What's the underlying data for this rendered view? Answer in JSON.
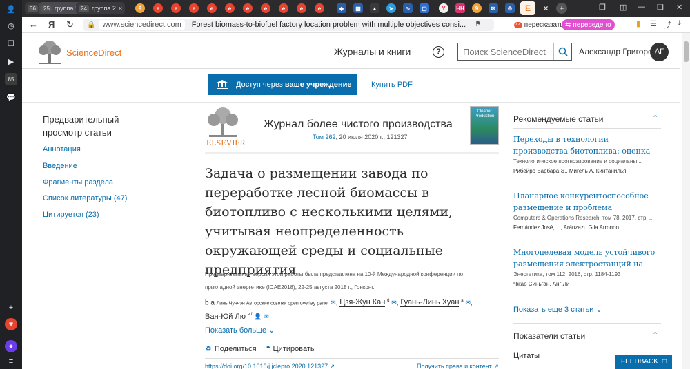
{
  "browser": {
    "tab_groups": [
      {
        "count": "36",
        "name": ""
      },
      {
        "count": "25",
        "name": "группа 1"
      },
      {
        "count": "24",
        "name": "группа 2"
      }
    ],
    "url_host": "www.sciencedirect.com",
    "page_title": "Forest biomass-to-biofuel factory location problem with multiple objectives consi...",
    "retell_label": "пересказать",
    "retell_badge": "44",
    "translated_label": "переведено",
    "rail_badge": "85"
  },
  "header": {
    "logo_text": "ScienceDirect",
    "journals_link": "Журналы и книги",
    "search_placeholder": "Поиск ScienceDirect",
    "user_name": "Александр Григоров",
    "avatar_initials": "АГ"
  },
  "access": {
    "label_prefix": "Доступ через",
    "label_bold": "ваше учреждение",
    "pdf_link": "Купить PDF"
  },
  "toc": {
    "title": "Предварительный просмотр статьи",
    "items": [
      {
        "label": "Аннотация",
        "count": ""
      },
      {
        "label": "Введение",
        "count": ""
      },
      {
        "label": "Фрагменты раздела",
        "count": ""
      },
      {
        "label": "Список литературы",
        "count": "(47)"
      },
      {
        "label": "Цитируется",
        "count": "(23)"
      }
    ]
  },
  "article": {
    "publisher": "ELSEVIER",
    "journal": "Журнал более чистого производства",
    "volume": "Том 262",
    "date_pages": ", 20 июля 2020 г., 121327",
    "cover_text": "Cleaner Production",
    "title": "Задача о размещении завода по переработке лесной биомассы в биотопливо с несколькими целями, учитывая неопределенность окружающей среды и социальные предприятия",
    "preprint": "Предварительная версия этой работы была представлена на 10-й Международной конференции по прикладной энергетике (ICAE2018), 22-25 августа 2018 г., Гонконг.",
    "author1_prefix": "b a",
    "author1_text": "Линь Чунчэн Авторские ссылки open overlay panel",
    "author2": "Цзя-Жун Кан",
    "author2_sup": "d",
    "author3": "Гуань-Линь Хуан",
    "author3_sup": "a",
    "author4": "Ван-Юй Лю",
    "author4_sup": "e f",
    "show_more": "Показать больше",
    "share": "Поделиться",
    "cite": "Цитировать",
    "doi": "https://doi.org/10.1016/j.jclepro.2020.121327",
    "rights": "Получить права и контент"
  },
  "recommended": {
    "heading": "Рекомендуемые статьи",
    "items": [
      {
        "title": "Переходы в технологии производства биотоплива: оценка социальных...",
        "source": "Технологическое прогнозирование и социальны...",
        "authors": "Рибейро Барбара Э., Мигель А. Кинтанилья"
      },
      {
        "title": "Планарное конкурентоспособное размещение и проблема проектировани...",
        "source": "Computers & Operations Research, том 78, 2017, стр. ...",
        "authors": "Fernández José, ..., Aránzazu Gila Arrondo"
      },
      {
        "title": "Многоцелевая модель устойчивого размещения электростанций на биомасс...",
        "source": "Энергетика, том 112, 2016, стр. 1184-1193",
        "authors": "Чжао Синьган, Анг Ли"
      }
    ],
    "show_more": "Показать еще 3 статьи",
    "metrics_heading": "Показатели статьи",
    "citations_label": "Цитаты",
    "feedback": "FEEDBACK"
  },
  "colors": {
    "brand_orange": "#e9711c",
    "link_blue": "#0a6eac",
    "access_bg": "#0a6eac"
  }
}
